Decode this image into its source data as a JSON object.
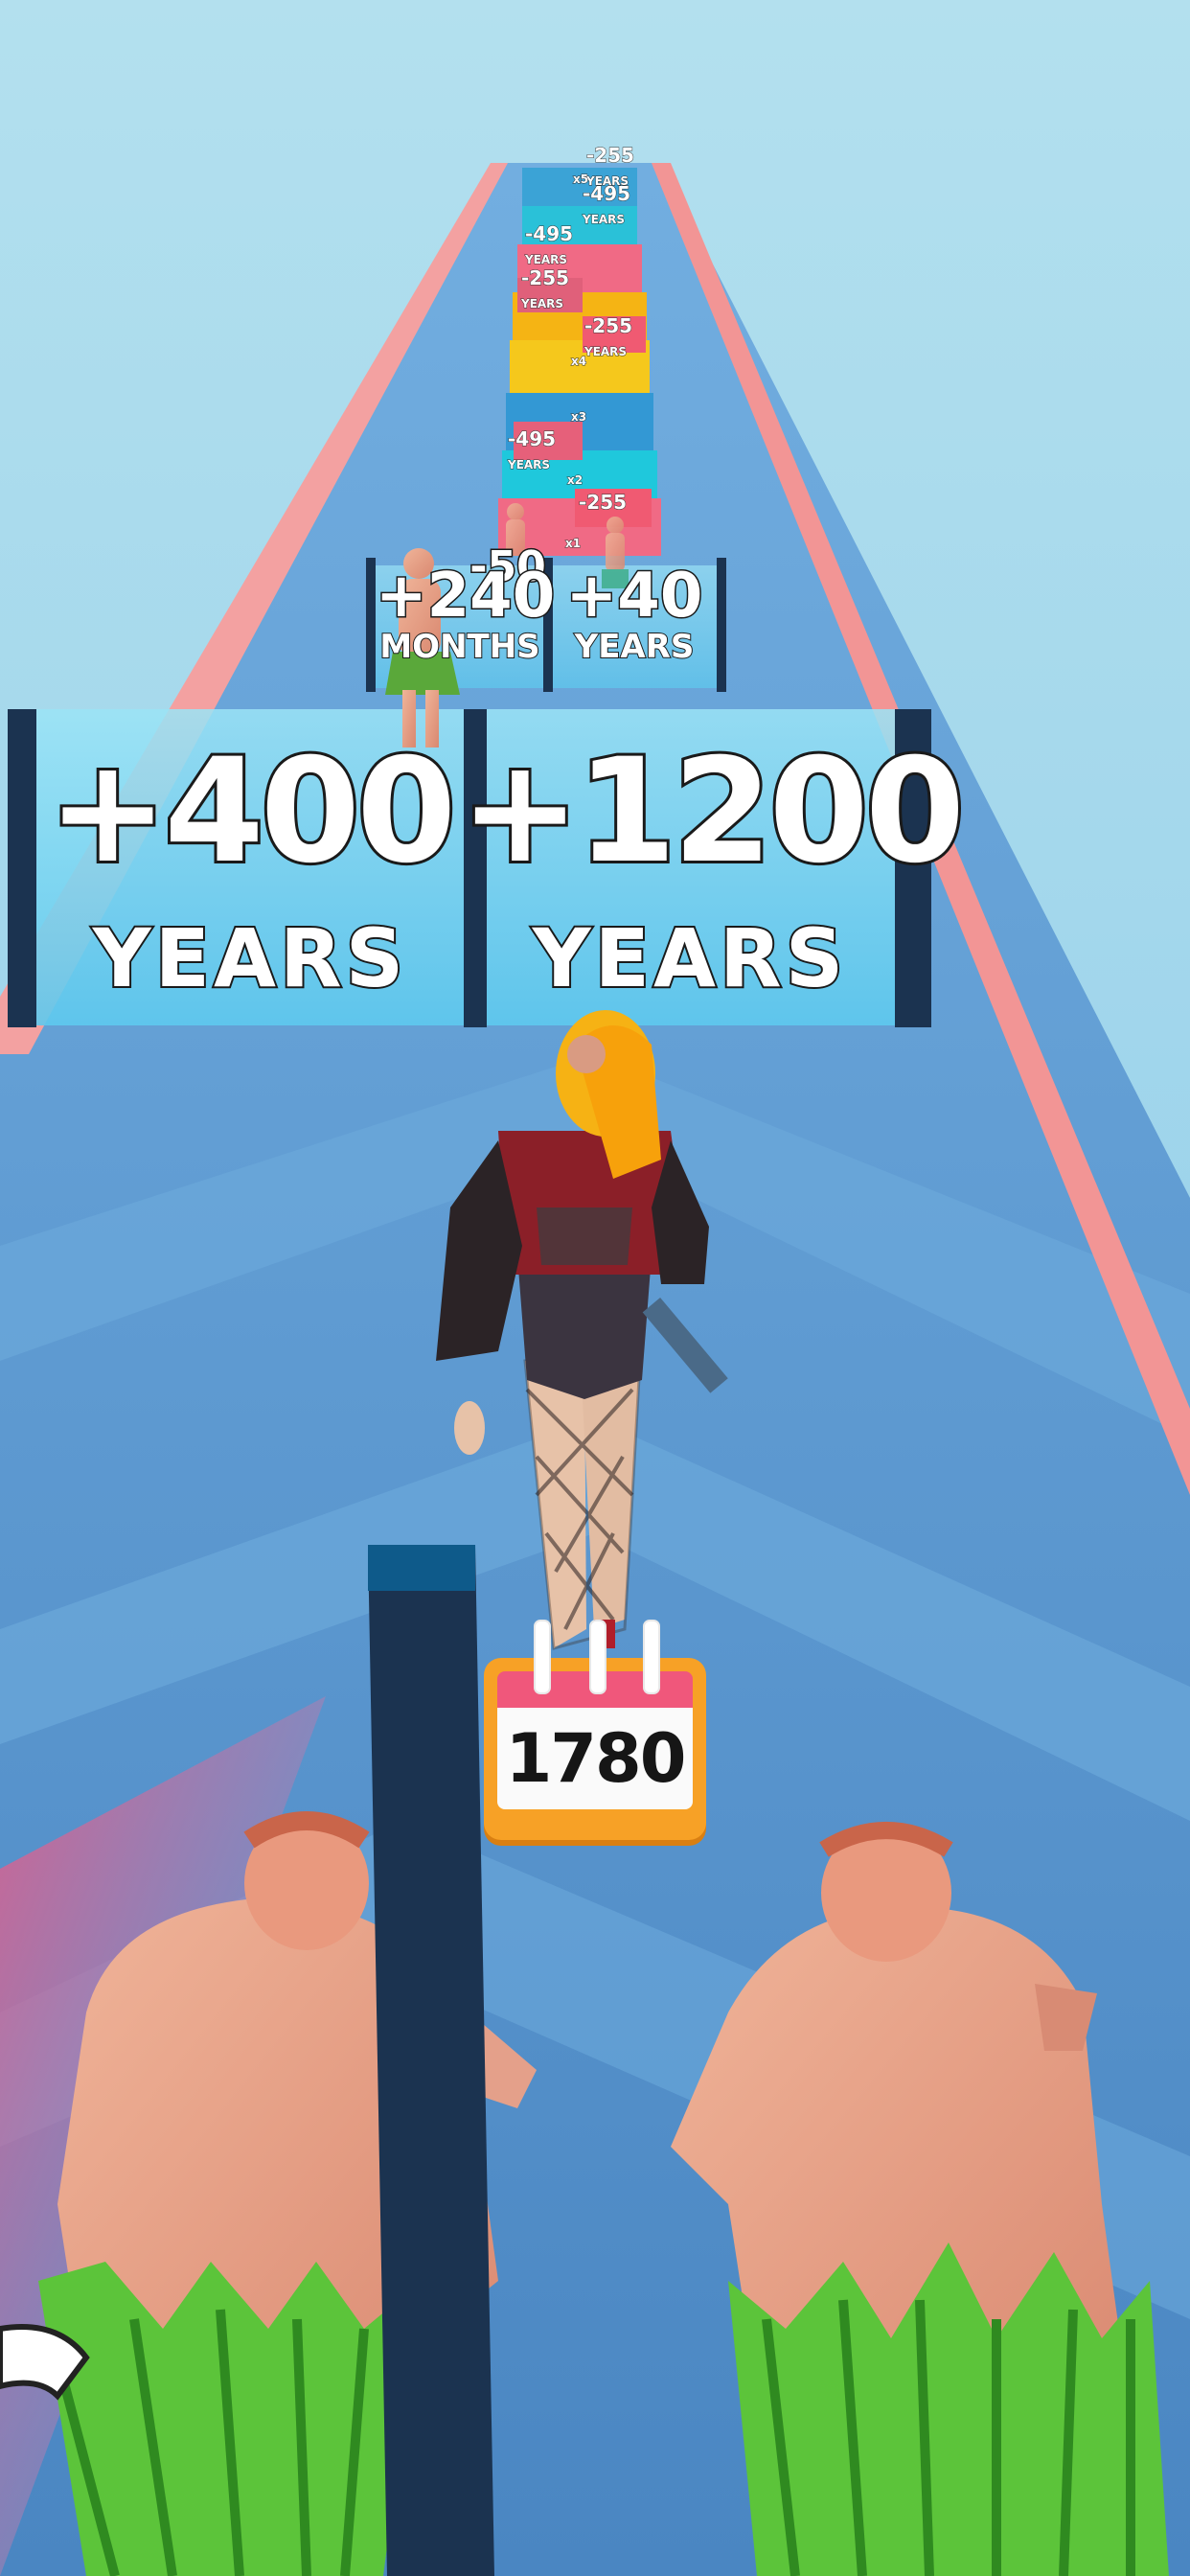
{
  "hud": {
    "year_counter": "1780"
  },
  "gates_front": {
    "left": {
      "value": "+400",
      "unit": "YEARS"
    },
    "right": {
      "value": "+1200",
      "unit": "YEARS"
    }
  },
  "gates_mid": {
    "left": {
      "value": "+240",
      "unit": "MONTHS"
    },
    "right": {
      "value": "+40",
      "unit": "YEARS"
    },
    "behind": "-50"
  },
  "distant_track": {
    "labels": [
      {
        "value": "-255",
        "unit": "YEARS"
      },
      {
        "value": "-495",
        "unit": "YEARS"
      },
      {
        "value": "-495",
        "unit": "YEARS"
      },
      {
        "value": "-255",
        "unit": "YEARS"
      },
      {
        "value": "-255",
        "unit": "YEARS"
      },
      {
        "value": "-495",
        "unit": "YEARS"
      },
      {
        "value": "-255",
        "unit": ""
      }
    ],
    "multipliers": [
      "x5",
      "x4",
      "x3",
      "x2",
      "x1"
    ]
  },
  "colors": {
    "sky": "#a9d9ea",
    "track": "#5b96c9",
    "rail": "#f29a9a",
    "gate_glass": "#7fd6ef",
    "post": "#1b3350",
    "calendar_orange": "#f7a126",
    "calendar_pink": "#f0577b"
  }
}
